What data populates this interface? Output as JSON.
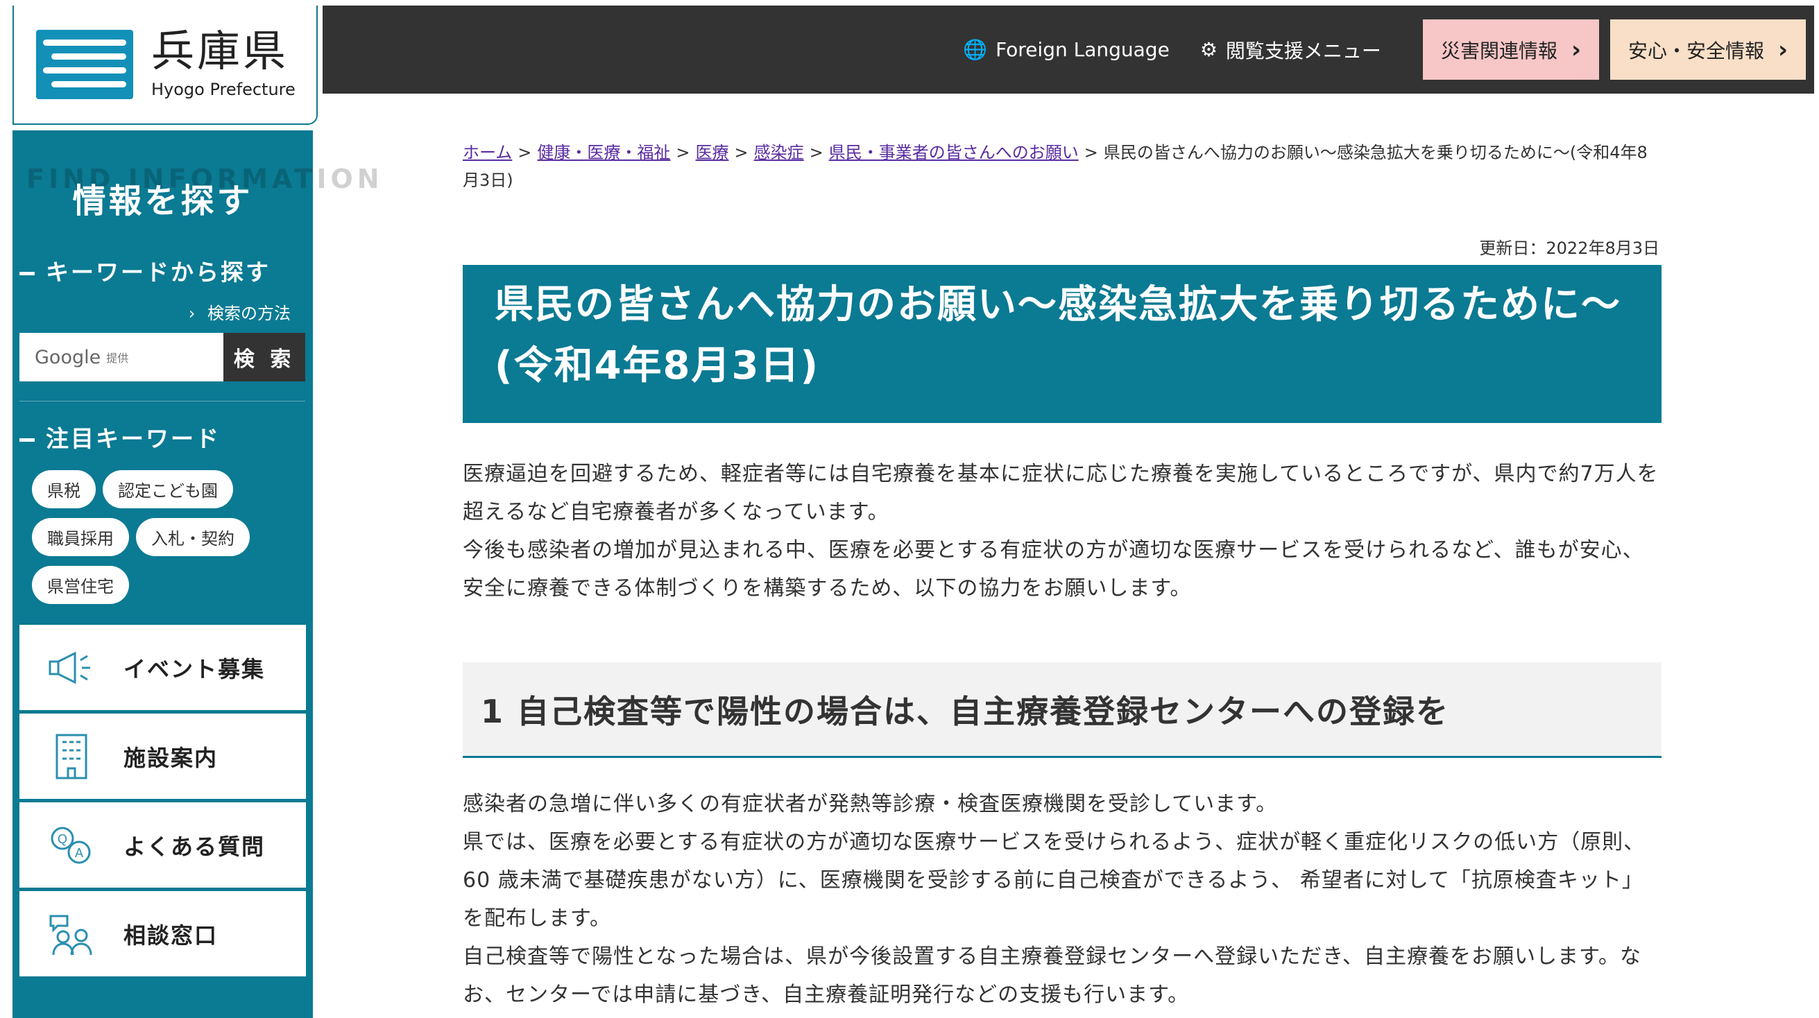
{
  "logo": {
    "name_ja": "兵庫県",
    "name_en": "Hyogo Prefecture"
  },
  "topnav": {
    "foreign_language": "Foreign Language",
    "assist_menu": "閲覧支援メニュー",
    "disaster_info": "災害関連情報",
    "safety_info": "安心・安全情報"
  },
  "sidebar": {
    "find_en": "FIND INFORMATION",
    "find_ja": "情報を探す",
    "keyword_search_title": "キーワードから探す",
    "search_howto": "検索の方法",
    "search_placeholder_brand": "Google",
    "search_placeholder_suffix": "提供",
    "search_button": "検 索",
    "featured_title": "注目キーワード",
    "keywords": [
      "県税",
      "認定こども園",
      "職員採用",
      "入札・契約",
      "県営住宅"
    ],
    "menu": [
      {
        "label": "イベント募集",
        "icon": "megaphone-icon"
      },
      {
        "label": "施設案内",
        "icon": "building-icon"
      },
      {
        "label": "よくある質問",
        "icon": "qa-icon"
      },
      {
        "label": "相談窓口",
        "icon": "consultation-icon"
      }
    ]
  },
  "breadcrumb": {
    "items": [
      "ホーム",
      "健康・医療・福祉",
      "医療",
      "感染症",
      "県民・事業者の皆さんへのお願い"
    ],
    "current": "県民の皆さんへ協力のお願い〜感染急拡大を乗り切るために〜(令和4年8月3日)",
    "separator": ">"
  },
  "article": {
    "updated": "更新日：2022年8月3日",
    "title": "県民の皆さんへ協力のお願い〜感染急拡大を乗り切るために〜(令和4年8月3日)",
    "intro_1": "医療逼迫を回避するため、軽症者等には自宅療養を基本に症状に応じた療養を実施しているところですが、県内で約7万人を超えるなど自宅療養者が多くなっています。",
    "intro_2": "今後も感染者の増加が見込まれる中、医療を必要とする有症状の方が適切な医療サービスを受けられるなど、誰もが安心、安全に療養できる体制づくりを構築するため、以下の協力をお願いします。",
    "section1_heading": "1 自己検査等で陽性の場合は、自主療養登録センターへの登録を",
    "section1_p1": "感染者の急増に伴い多くの有症状者が発熱等診療・検査医療機関を受診しています。",
    "section1_p2": "県では、医療を必要とする有症状の方が適切な医療サービスを受けられるよう、症状が軽く重症化リスクの低い方（原則、60 歳未満で基礎疾患がない方）に、医療機関を受診する前に自己検査ができるよう、 希望者に対して「抗原検査キット」を配布します。",
    "section1_p3": "自己検査等で陽性となった場合は、県が今後設置する自主療養登録センターへ登録いただき、自主療養をお願いします。なお、センターでは申請に基づき、自主療養証明発行などの支援も行います。"
  },
  "colors": {
    "brand_teal": "#0b7a93",
    "topbar": "#333333",
    "disaster_bg": "#f7c6c6",
    "safety_bg": "#f9dfc7"
  }
}
